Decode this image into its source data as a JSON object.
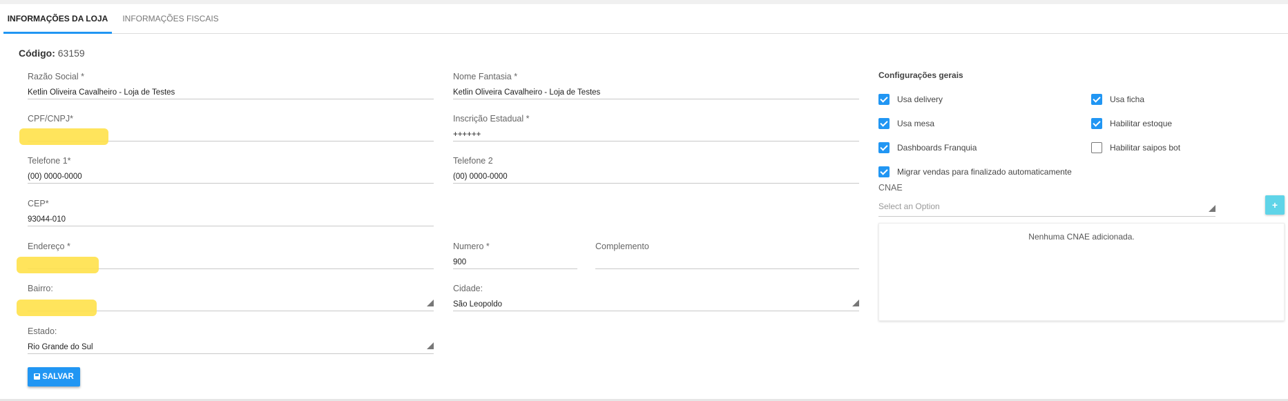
{
  "tabs": [
    {
      "label": "INFORMAÇÕES DA LOJA",
      "active": true
    },
    {
      "label": "INFORMAÇÕES FISCAIS",
      "active": false
    }
  ],
  "codigo": {
    "label": "Código:",
    "value": "63159"
  },
  "fields": {
    "razao_social": {
      "label": "Razão Social *",
      "value": "Ketlin Oliveira Cavalheiro - Loja de Testes"
    },
    "nome_fantasia": {
      "label": "Nome Fantasia *",
      "value": "Ketlin Oliveira Cavalheiro - Loja de Testes"
    },
    "cpf_cnpj": {
      "label": "CPF/CNPJ*",
      "value": "",
      "redacted": true
    },
    "inscricao_estadual": {
      "label": "Inscrição Estadual *",
      "value": "++++++"
    },
    "telefone1": {
      "label": "Telefone 1*",
      "value": "(00) 0000-0000"
    },
    "telefone2": {
      "label": "Telefone 2",
      "value": "(00) 0000-0000"
    },
    "cep": {
      "label": "CEP*",
      "value": "93044-010"
    },
    "endereco": {
      "label": "Endereço *",
      "value": "",
      "redacted": true
    },
    "numero": {
      "label": "Numero *",
      "value": "900"
    },
    "complemento": {
      "label": "Complemento",
      "value": ""
    },
    "bairro": {
      "label": "Bairro:",
      "value": "",
      "redacted": true
    },
    "cidade": {
      "label": "Cidade:",
      "value": "São Leopoldo"
    },
    "estado": {
      "label": "Estado:",
      "value": "Rio Grande do Sul"
    }
  },
  "save_button": {
    "label": "SALVAR",
    "icon": "floppy-disk-icon",
    "color": "#2196f3"
  },
  "config": {
    "title": "Configurações gerais",
    "options": [
      {
        "label": "Usa delivery",
        "checked": true
      },
      {
        "label": "Usa ficha",
        "checked": true
      },
      {
        "label": "Usa mesa",
        "checked": true
      },
      {
        "label": "Habilitar estoque",
        "checked": true
      },
      {
        "label": "Dashboards Franquia",
        "checked": true
      },
      {
        "label": "Habilitar saipos bot",
        "checked": false
      },
      {
        "label": "Migrar vendas para finalizado automaticamente",
        "checked": true
      }
    ]
  },
  "cnae": {
    "label": "CNAE",
    "placeholder": "Select an Option",
    "add_label": "+",
    "empty_message": "Nenhuma CNAE adicionada."
  },
  "colors": {
    "accent": "#2196f3",
    "add_button": "#5fd4e8",
    "redaction": "#ffe14a"
  }
}
